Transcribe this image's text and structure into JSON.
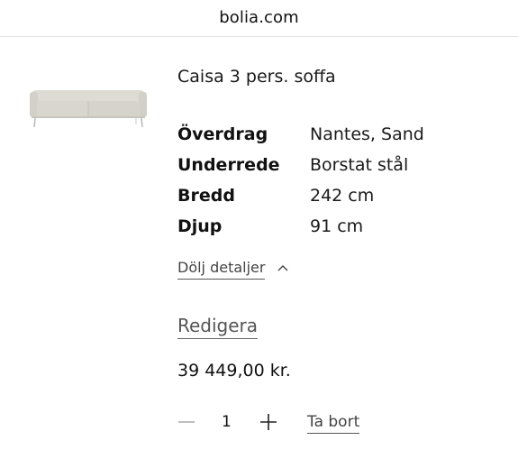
{
  "browser": {
    "url": "bolia.com"
  },
  "product": {
    "image_icon": "sofa-thumbnail",
    "title": "Caisa 3 pers. soffa",
    "specs": [
      {
        "key": "Överdrag",
        "value": "Nantes, Sand"
      },
      {
        "key": "Underrede",
        "value": "Borstat stål"
      },
      {
        "key": "Bredd",
        "value": "242 cm"
      },
      {
        "key": "Djup",
        "value": "91 cm"
      }
    ],
    "toggle_details_label": "Dölj detaljer",
    "toggle_icon": "chevron-up-icon",
    "edit_label": "Redigera",
    "price": "39 449,00 kr.",
    "quantity": "1",
    "remove_label": "Ta bort"
  },
  "colors": {
    "background": "#ffffff",
    "text": "#1a1a1a",
    "sofa_fabric": "#d9d6d0",
    "sofa_legs": "#b8b8b8"
  }
}
